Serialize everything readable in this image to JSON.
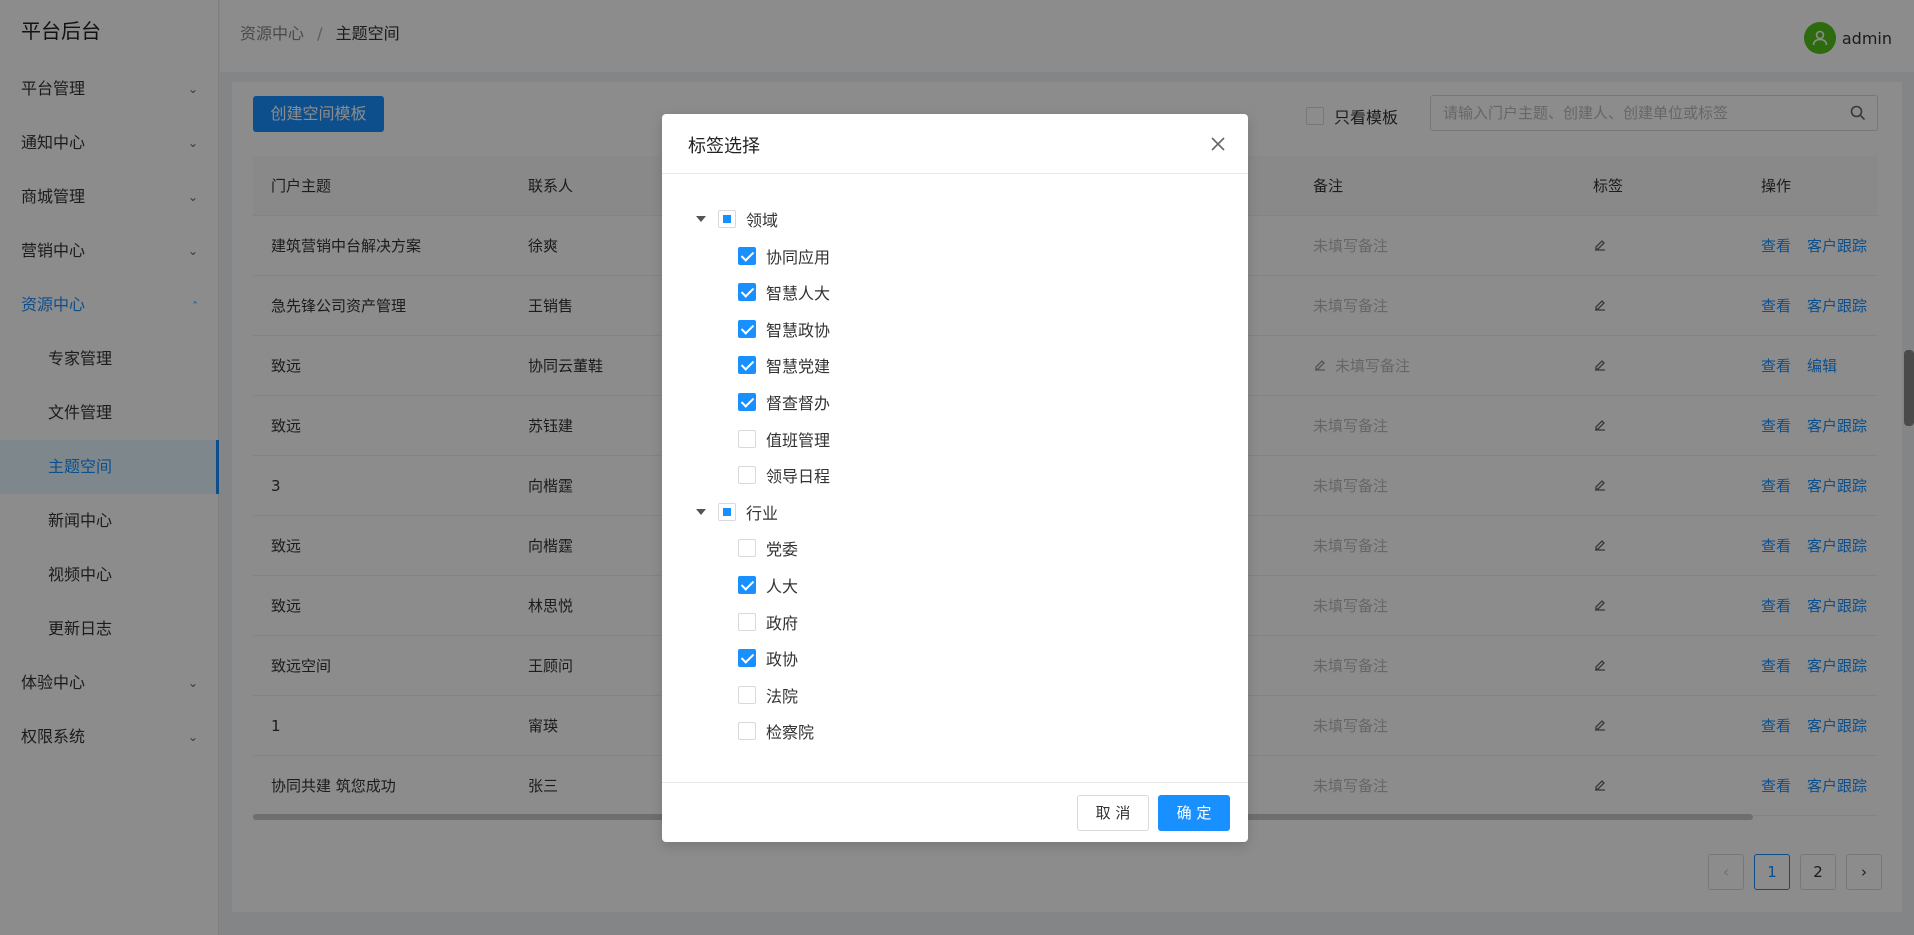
{
  "sidebar": {
    "brand": "平台后台",
    "items": [
      {
        "label": "平台管理",
        "chevron": "down"
      },
      {
        "label": "通知中心",
        "chevron": "down"
      },
      {
        "label": "商城管理",
        "chevron": "down"
      },
      {
        "label": "营销中心",
        "chevron": "down"
      },
      {
        "label": "资源中心",
        "chevron": "up"
      },
      {
        "label": "体验中心",
        "chevron": "down"
      },
      {
        "label": "权限系统",
        "chevron": "down"
      }
    ],
    "sub_items": [
      {
        "label": "专家管理"
      },
      {
        "label": "文件管理"
      },
      {
        "label": "主题空间"
      },
      {
        "label": "新闻中心"
      },
      {
        "label": "视频中心"
      },
      {
        "label": "更新日志"
      }
    ]
  },
  "header": {
    "breadcrumb": [
      "资源中心",
      "主题空间"
    ],
    "separator": "/",
    "user": "admin"
  },
  "toolbar": {
    "create_label": "创建空间模板",
    "template_only_label": "只看模板",
    "search_placeholder": "请输入门户主题、创建人、创建单位或标签"
  },
  "table": {
    "columns": {
      "theme": "门户主题",
      "contact": "联系人",
      "remark": "备注",
      "tag": "标签",
      "op": "操作"
    },
    "rows": [
      {
        "theme": "建筑营销中台解决方案",
        "contact": "徐爽",
        "remark": "未填写备注",
        "op1": "查看",
        "op2": "客户跟踪"
      },
      {
        "theme": "急先锋公司资产管理",
        "contact": "王销售",
        "remark": "未填写备注",
        "op1": "查看",
        "op2": "客户跟踪"
      },
      {
        "theme": "致远",
        "contact": "协同云董鞋",
        "remark": "未填写备注",
        "op1": "查看",
        "op2": "编辑"
      },
      {
        "theme": "致远",
        "contact": "苏钰建",
        "remark": "未填写备注",
        "op1": "查看",
        "op2": "客户跟踪"
      },
      {
        "theme": "3",
        "contact": "向楷霆",
        "remark": "未填写备注",
        "op1": "查看",
        "op2": "客户跟踪"
      },
      {
        "theme": "致远",
        "contact": "向楷霆",
        "remark": "未填写备注",
        "op1": "查看",
        "op2": "客户跟踪"
      },
      {
        "theme": "致远",
        "contact": "林思悦",
        "remark": "未填写备注",
        "op1": "查看",
        "op2": "客户跟踪"
      },
      {
        "theme": "致远空间",
        "contact": "王顾问",
        "remark": "未填写备注",
        "op1": "查看",
        "op2": "客户跟踪"
      },
      {
        "theme": "1",
        "contact": "甯瑛",
        "remark": "未填写备注",
        "op1": "查看",
        "op2": "客户跟踪"
      },
      {
        "theme": "协同共建 筑您成功",
        "contact": "张三",
        "remark": "未填写备注",
        "op1": "查看",
        "op2": "客户跟踪"
      }
    ]
  },
  "pagination": {
    "pages": [
      "1",
      "2"
    ],
    "current": "1",
    "prev": "‹",
    "next": "›"
  },
  "modal": {
    "title": "标签选择",
    "cancel_label": "取 消",
    "ok_label": "确 定",
    "tree": [
      {
        "label": "领域",
        "state": "partial",
        "children": [
          {
            "label": "协同应用",
            "checked": true
          },
          {
            "label": "智慧人大",
            "checked": true
          },
          {
            "label": "智慧政协",
            "checked": true
          },
          {
            "label": "智慧党建",
            "checked": true
          },
          {
            "label": "督查督办",
            "checked": true
          },
          {
            "label": "值班管理",
            "checked": false
          },
          {
            "label": "领导日程",
            "checked": false
          }
        ]
      },
      {
        "label": "行业",
        "state": "partial",
        "children": [
          {
            "label": "党委",
            "checked": false
          },
          {
            "label": "人大",
            "checked": true
          },
          {
            "label": "政府",
            "checked": false
          },
          {
            "label": "政协",
            "checked": true
          },
          {
            "label": "法院",
            "checked": false
          },
          {
            "label": "检察院",
            "checked": false
          }
        ]
      }
    ]
  }
}
